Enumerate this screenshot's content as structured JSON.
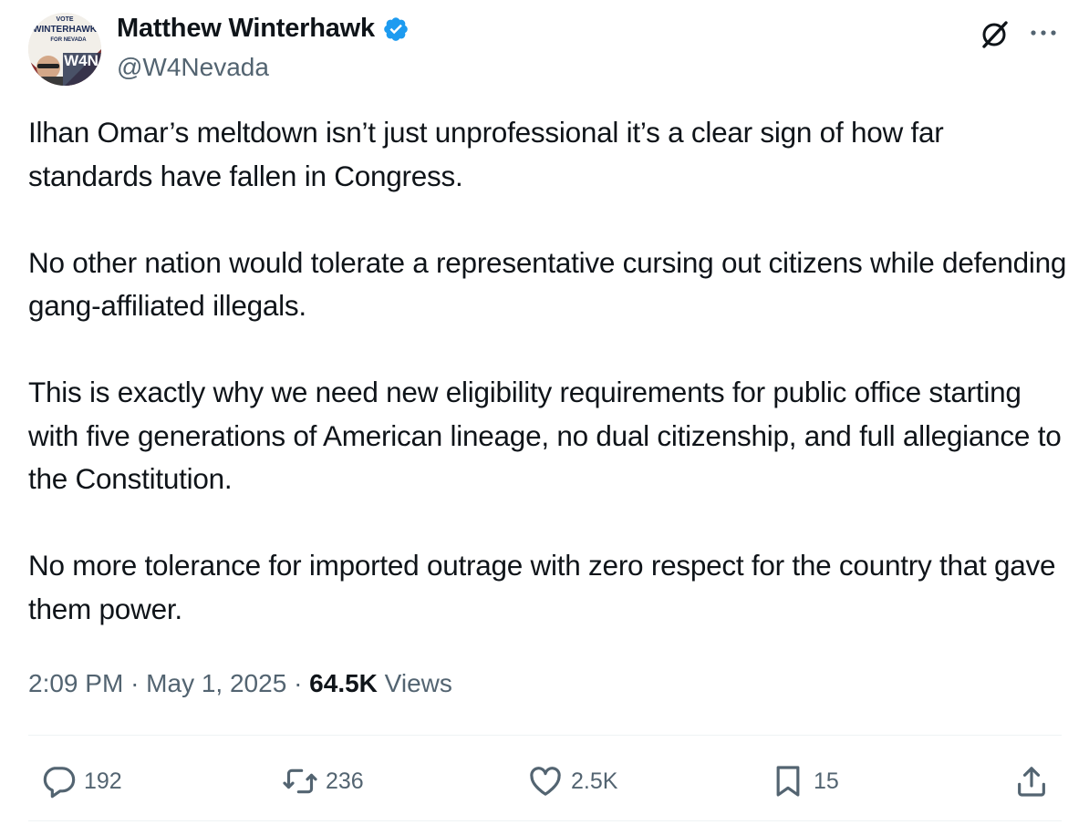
{
  "author": {
    "display_name": "Matthew Winterhawk",
    "handle": "@W4Nevada",
    "verified": true,
    "avatar_text": {
      "line1": "VOTE",
      "line2": "WINTERHAWK",
      "line3": "FOR NEVADA",
      "monogram": "W4N"
    }
  },
  "tweet": {
    "paragraphs": [
      "Ilhan Omar’s meltdown isn’t just unprofessional it’s a clear sign of how far standards have fallen in Congress.",
      "No other nation would tolerate a representative cursing out citizens while defending gang-affiliated illegals.",
      "This is exactly why we need new eligibility requirements for public office starting with five generations of American lineage, no dual citizenship, and full allegiance to the Constitution.",
      "No more tolerance for imported outrage with zero respect for the country that gave them power."
    ]
  },
  "meta": {
    "time": "2:09 PM",
    "separator": "·",
    "date": "May 1, 2025",
    "views_count": "64.5K",
    "views_label": "Views"
  },
  "actions": {
    "replies": "192",
    "reposts": "236",
    "likes": "2.5K",
    "bookmarks": "15"
  },
  "colors": {
    "text": "#0f1419",
    "secondary": "#536471",
    "verified_blue": "#1d9bf0",
    "divider": "#eff3f4"
  },
  "icons": [
    "grok-icon",
    "more-icon",
    "reply-icon",
    "repost-icon",
    "like-icon",
    "bookmark-icon",
    "share-icon",
    "verified-badge-icon"
  ]
}
